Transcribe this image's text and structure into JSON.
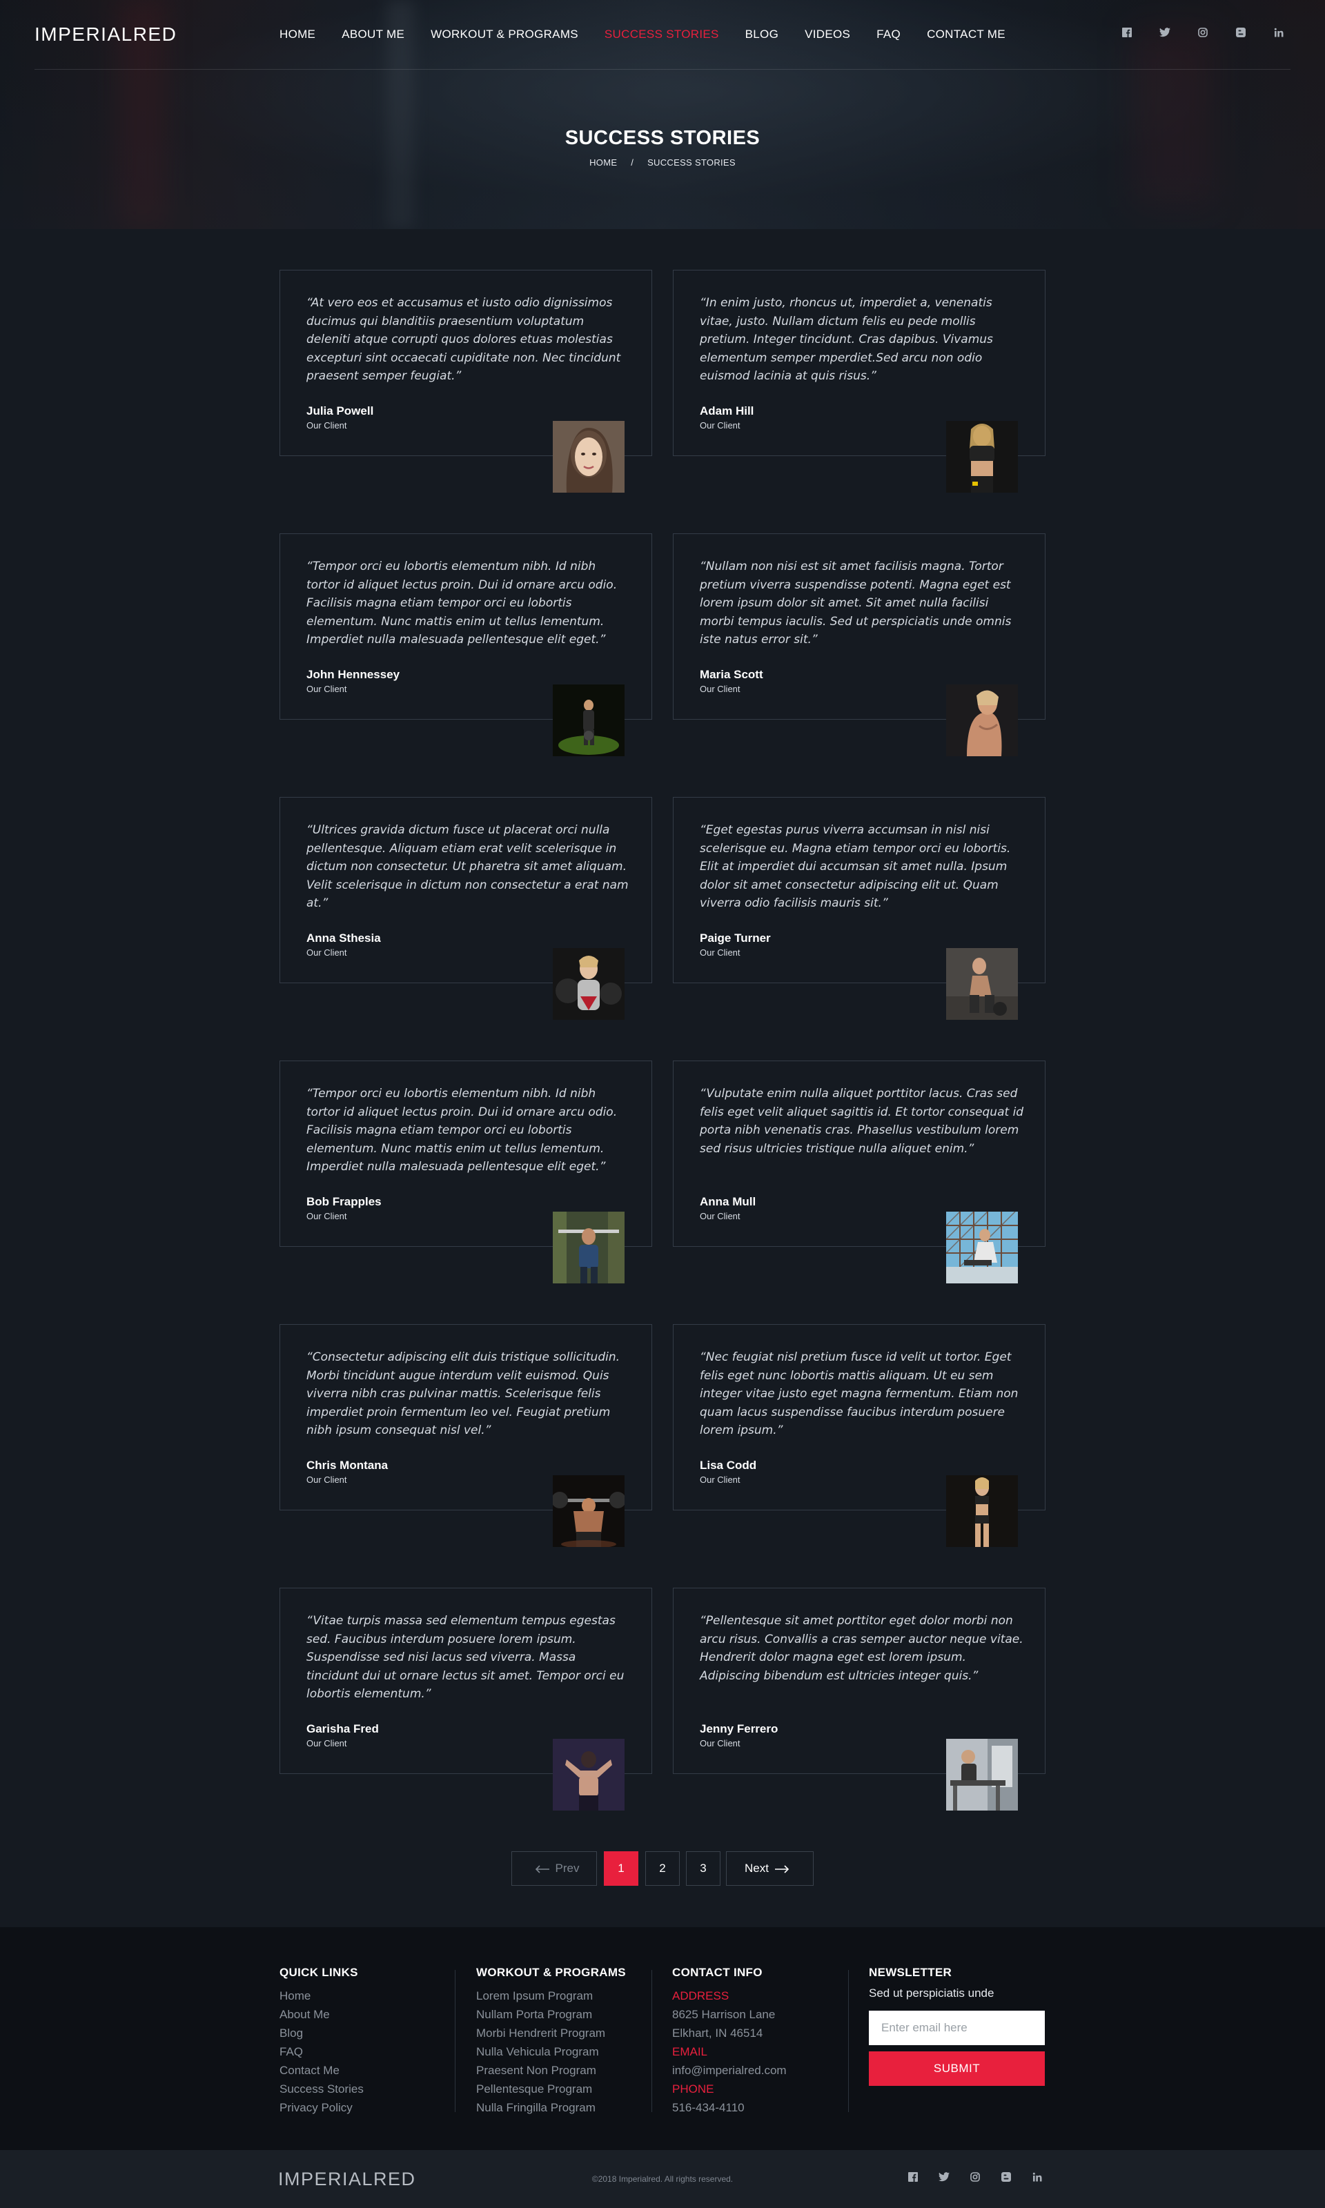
{
  "header": {
    "logo": "IMPERIALRED",
    "nav": [
      "HOME",
      "ABOUT ME",
      "WORKOUT & PROGRAMS",
      "SUCCESS STORIES",
      "BLOG",
      "VIDEOS",
      "FAQ",
      "CONTACT ME"
    ],
    "active_nav": "SUCCESS STORIES",
    "social_icons": [
      "facebook-icon",
      "twitter-icon",
      "instagram-icon",
      "blogger-icon",
      "linkedin-icon"
    ]
  },
  "hero": {
    "title": "SUCCESS STORIES",
    "breadcrumb": [
      "HOME",
      "SUCCESS STORIES"
    ],
    "breadcrumb_separator": "/"
  },
  "testimonials": [
    {
      "quote": "“At vero eos et accusamus et iusto odio dignissimos ducimus qui blanditiis praesentium voluptatum deleniti atque corrupti quos dolores etuas molestias excepturi sint occaecati cupiditate non. Nec tincidunt praesent semper feugiat.”",
      "name": "Julia Powell",
      "role": "Our Client"
    },
    {
      "quote": "“In enim justo, rhoncus ut, imperdiet a, venenatis vitae, justo. Nullam dictum felis eu pede mollis pretium. Integer tincidunt. Cras dapibus. Vivamus elementum semper mperdiet.Sed arcu non odio euismod lacinia at quis risus.”",
      "name": "Adam Hill",
      "role": "Our Client"
    },
    {
      "quote": "“Tempor orci eu lobortis elementum nibh. Id nibh tortor id aliquet lectus proin. Dui id ornare arcu odio. Facilisis magna etiam tempor orci eu lobortis elementum. Nunc mattis enim ut tellus lementum. Imperdiet nulla malesuada pellentesque elit eget.”",
      "name": "John Hennessey",
      "role": "Our Client"
    },
    {
      "quote": "“Nullam non nisi est sit amet facilisis magna. Tortor pretium viverra suspendisse potenti. Magna eget est lorem ipsum dolor sit amet. Sit amet nulla facilisi morbi tempus iaculis. Sed ut perspiciatis unde omnis iste natus error sit.”",
      "name": "Maria Scott",
      "role": "Our Client"
    },
    {
      "quote": "“Ultrices gravida dictum fusce ut placerat orci nulla pellentesque. Aliquam etiam erat velit scelerisque in dictum non consectetur. Ut pharetra sit amet aliquam. Velit scelerisque in dictum non consectetur a erat nam at.”",
      "name": "Anna Sthesia",
      "role": "Our Client"
    },
    {
      "quote": "“Eget egestas purus viverra accumsan in nisl nisi scelerisque eu. Magna etiam tempor orci eu lobortis. Elit at imperdiet dui accumsan sit amet nulla. Ipsum dolor sit amet consectetur adipiscing elit ut. Quam viverra odio facilisis mauris sit.”",
      "name": "Paige Turner",
      "role": "Our Client"
    },
    {
      "quote": "“Tempor orci eu lobortis elementum nibh. Id nibh tortor id aliquet lectus proin. Dui id ornare arcu odio. Facilisis magna etiam tempor orci eu lobortis elementum. Nunc mattis enim ut tellus lementum. Imperdiet nulla malesuada pellentesque elit eget.”",
      "name": "Bob Frapples",
      "role": "Our Client"
    },
    {
      "quote": "“Vulputate enim nulla aliquet porttitor lacus. Cras sed felis eget velit aliquet sagittis id. Et tortor consequat id porta nibh venenatis cras. Phasellus vestibulum lorem sed risus ultricies tristique nulla aliquet enim.”",
      "name": "Anna Mull",
      "role": "Our Client"
    },
    {
      "quote": "“Consectetur adipiscing elit duis tristique sollicitudin. Morbi tincidunt augue interdum velit euismod. Quis viverra nibh cras pulvinar mattis. Scelerisque felis imperdiet proin fermentum leo vel. Feugiat pretium nibh ipsum consequat nisl vel.”",
      "name": "Chris Montana",
      "role": "Our Client"
    },
    {
      "quote": "“Nec feugiat nisl pretium fusce id velit ut tortor. Eget felis eget nunc lobortis mattis aliquam. Ut eu sem integer vitae justo eget magna fermentum. Etiam non quam lacus suspendisse faucibus interdum posuere lorem ipsum.”",
      "name": "Lisa Codd",
      "role": "Our Client"
    },
    {
      "quote": "“Vitae turpis massa sed elementum tempus egestas sed. Faucibus interdum posuere lorem ipsum. Suspendisse sed nisi lacus sed viverra. Massa tincidunt dui ut ornare lectus sit amet. Tempor orci eu lobortis elementum.”",
      "name": "Garisha Fred",
      "role": "Our Client"
    },
    {
      "quote": "“Pellentesque sit amet porttitor eget dolor morbi non arcu risus. Convallis a cras semper auctor neque vitae. Hendrerit dolor magna eget est lorem ipsum. Adipiscing bibendum est ultricies integer quis.”",
      "name": "Jenny Ferrero",
      "role": "Our Client"
    }
  ],
  "pagination": {
    "prev_label": "Prev",
    "next_label": "Next",
    "pages": [
      "1",
      "2",
      "3"
    ],
    "current": "1"
  },
  "footer": {
    "quick_links": {
      "heading": "QUICK LINKS",
      "items": [
        "Home",
        "About Me",
        "Blog",
        "FAQ",
        "Contact Me",
        "Success Stories",
        "Privacy Policy"
      ]
    },
    "programs": {
      "heading": "WORKOUT & PROGRAMS",
      "items": [
        "Lorem Ipsum Program",
        "Nullam Porta Program",
        "Morbi Hendrerit Program",
        "Nulla Vehicula Program",
        "Praesent Non Program",
        "Pellentesque Program",
        "Nulla Fringilla Program"
      ]
    },
    "contact": {
      "heading": "CONTACT INFO",
      "address_label": "ADDRESS",
      "address_line1": "8625 Harrison Lane",
      "address_line2": "Elkhart, IN 46514",
      "email_label": "EMAIL",
      "email": "info@imperialred.com",
      "phone_label": "PHONE",
      "phone": "516-434-4110"
    },
    "newsletter": {
      "heading": "NEWSLETTER",
      "text": "Sed ut perspiciatis unde",
      "placeholder": "Enter email here",
      "button": "SUBMIT"
    }
  },
  "bottom_bar": {
    "logo": "IMPERIALRED",
    "copyright": "©2018 Imperialred. All rights reserved."
  },
  "colors": {
    "accent": "#e8203d",
    "background": "#151a21",
    "footer": "#0d1015"
  }
}
